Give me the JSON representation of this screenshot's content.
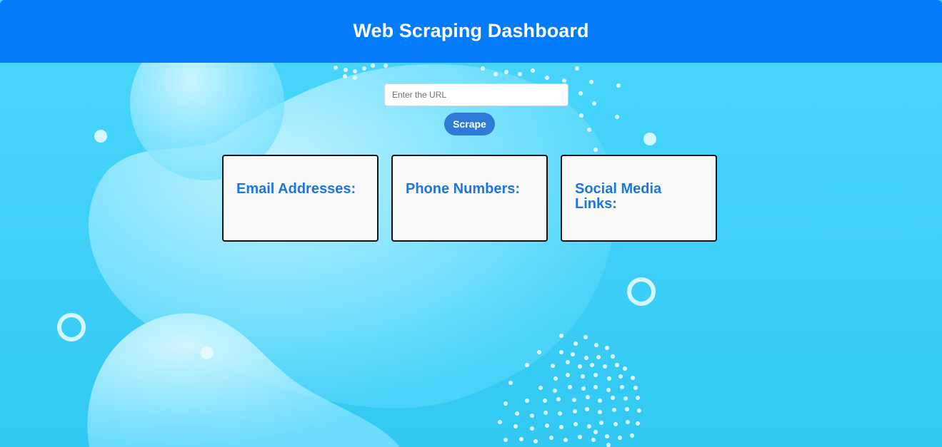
{
  "header": {
    "title": "Web Scraping Dashboard"
  },
  "search": {
    "placeholder": "Enter the URL",
    "value": ""
  },
  "actions": {
    "scrape_label": "Scrape"
  },
  "results": {
    "email_heading": "Email Addresses:",
    "phone_heading": "Phone Numbers:",
    "social_heading": "Social Media Links:"
  },
  "colors": {
    "header_bg": "#037bfb",
    "button_bg": "#2e7bd7",
    "heading_text": "#1a76e2",
    "card_bg": "#faf9f9",
    "page_bg": "#3fd0f8"
  },
  "icons": {
    "background": "decorative-bubbles"
  }
}
